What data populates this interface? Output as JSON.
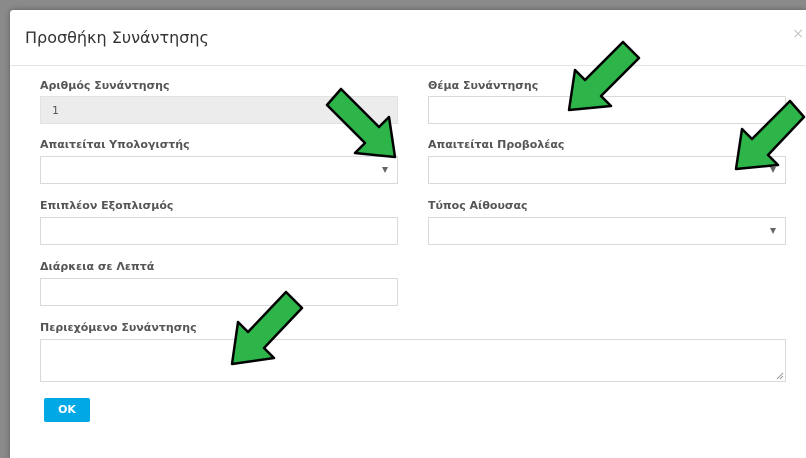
{
  "dialog": {
    "title": "Προσθήκη Συνάντησης",
    "close_symbol": "×"
  },
  "form": {
    "meeting_number": {
      "label": "Αριθμός Συνάντησης",
      "value": "1"
    },
    "meeting_subject": {
      "label": "Θέμα Συνάντησης",
      "value": ""
    },
    "computer_required": {
      "label": "Απαιτείται Υπολογιστής",
      "value": ""
    },
    "projector_required": {
      "label": "Απαιτείται Προβολέας",
      "value": ""
    },
    "extra_equipment": {
      "label": "Επιπλέον Εξοπλισμός",
      "value": ""
    },
    "room_type": {
      "label": "Τύπος Αίθουσας",
      "value": ""
    },
    "duration_minutes": {
      "label": "Διάρκεια σε Λεπτά",
      "value": ""
    },
    "meeting_content": {
      "label": "Περιεχόμενο Συνάντησης",
      "value": ""
    },
    "ok_label": "OK"
  },
  "colors": {
    "ok_button": "#00a8e6",
    "arrow_fill": "#2db54a",
    "arrow_stroke": "#000000"
  }
}
